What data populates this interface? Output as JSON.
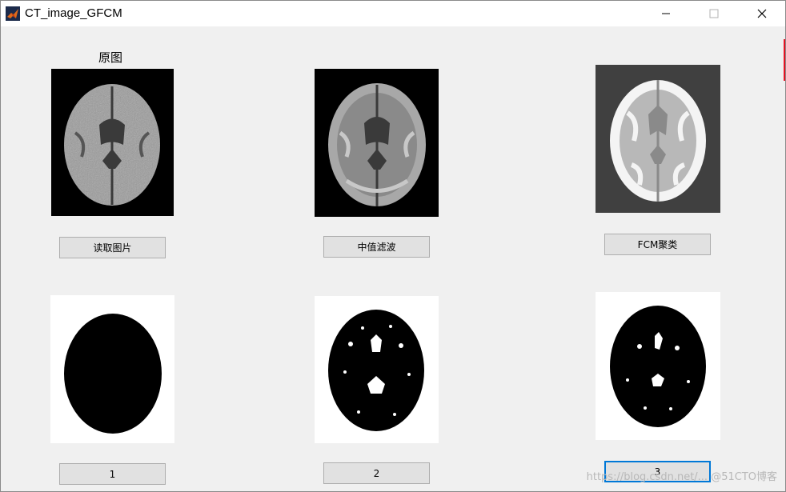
{
  "window": {
    "title": "CT_image_GFCM",
    "icon": "matlab-icon",
    "controls": [
      "minimize-icon",
      "maximize-icon",
      "close-icon"
    ]
  },
  "axes": {
    "original_title": "原图"
  },
  "buttons": {
    "read_image": "读取图片",
    "median_filter": "中值滤波",
    "fcm_cluster": "FCM聚类",
    "cluster_1": "1",
    "cluster_2": "2",
    "cluster_3": "3"
  },
  "focused_button": "cluster_3",
  "watermark": "https://blog.csdn.net/... @51CTO博客",
  "colors": {
    "window_bg": "#f0f0f0",
    "button_bg": "#e1e1e1",
    "button_border": "#adadad",
    "focus": "#0078d7",
    "fcm_background": "#404040"
  }
}
